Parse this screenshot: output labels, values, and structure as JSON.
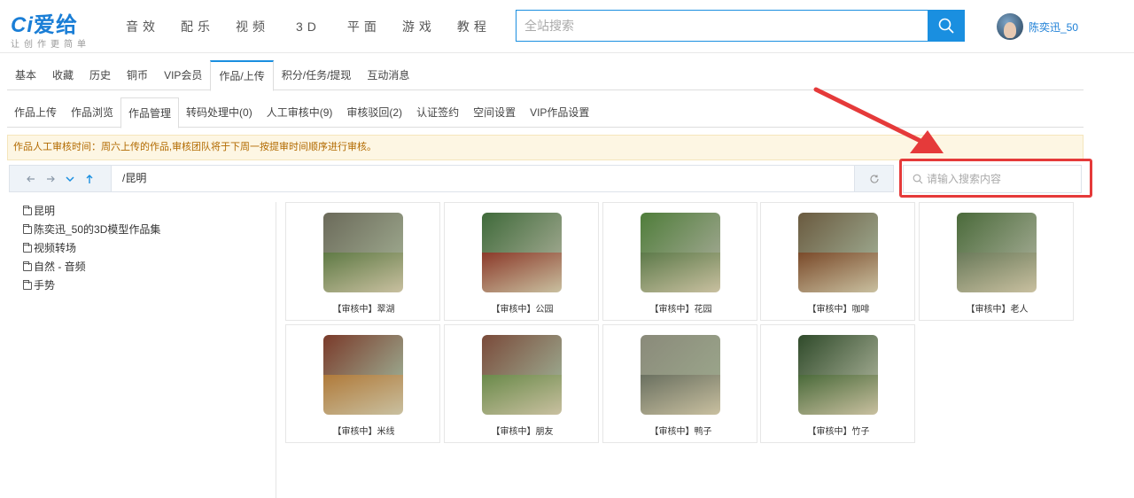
{
  "logo": {
    "brand_prefix": "Ci",
    "brand_name": "爱给",
    "slogan": "让创作更简单"
  },
  "nav": [
    "音效",
    "配乐",
    "视频",
    "3D",
    "平面",
    "游戏",
    "教程"
  ],
  "search": {
    "placeholder": "全站搜索"
  },
  "user": {
    "name": "陈奕迅_50"
  },
  "tabs_primary": [
    {
      "label": "基本"
    },
    {
      "label": "收藏"
    },
    {
      "label": "历史"
    },
    {
      "label": "铜币"
    },
    {
      "label": "VIP会员"
    },
    {
      "label": "作品/上传",
      "active": true
    },
    {
      "label": "积分/任务/提现"
    },
    {
      "label": "互动消息"
    }
  ],
  "tabs_secondary": [
    {
      "label": "作品上传"
    },
    {
      "label": "作品浏览"
    },
    {
      "label": "作品管理",
      "active": true
    },
    {
      "label": "转码处理中(0)"
    },
    {
      "label": "人工审核中(9)"
    },
    {
      "label": "审核驳回(2)"
    },
    {
      "label": "认证签约"
    },
    {
      "label": "空间设置"
    },
    {
      "label": "VIP作品设置"
    }
  ],
  "notice": "作品人工审核时间：周六上传的作品,审核团队将于下周一按提审时间顺序进行审核。",
  "path": "/昆明",
  "file_search": {
    "placeholder": "请输入搜索内容"
  },
  "folders": [
    "昆明",
    "陈奕迅_50的3D模型作品集",
    "视频转场",
    "自然 - 音频",
    "手势"
  ],
  "colors": {
    "accent": "#1a8fe0",
    "annotation": "#e53a3a",
    "notice_text": "#b26a00"
  },
  "works": [
    {
      "label": "【审核中】翠湖",
      "top": "#6b6a5a",
      "bottom": "#5f7a45"
    },
    {
      "label": "【审核中】公园",
      "top": "#3f6a3a",
      "bottom": "#8b3a2a"
    },
    {
      "label": "【审核中】花园",
      "top": "#4f7d3a",
      "bottom": "#5d7a4a"
    },
    {
      "label": "【审核中】咖啡",
      "top": "#6a5a3f",
      "bottom": "#7a4a2a"
    },
    {
      "label": "【审核中】老人",
      "top": "#4a6a3a",
      "bottom": "#6a7a5a"
    },
    {
      "label": "【审核中】米线",
      "top": "#7a3a2a",
      "bottom": "#b07a3a"
    },
    {
      "label": "【审核中】朋友",
      "top": "#7a4a3a",
      "bottom": "#6a8a4a"
    },
    {
      "label": "【审核中】鸭子",
      "top": "#8a8a7a",
      "bottom": "#6a7060"
    },
    {
      "label": "【审核中】竹子",
      "top": "#2f4a2a",
      "bottom": "#4a6a3a"
    }
  ]
}
